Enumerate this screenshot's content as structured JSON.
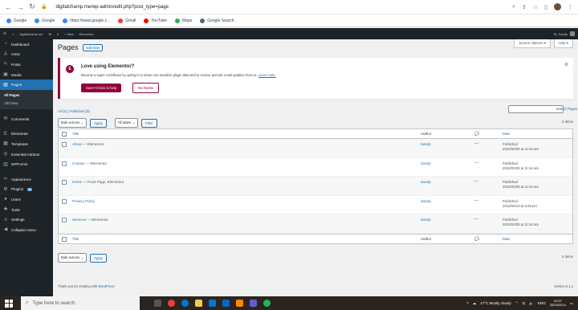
{
  "browser": {
    "url": "digitalchamp.me/wp-admin/edit.php?post_type=page",
    "lock": "🔒"
  },
  "bookmarks": [
    {
      "label": "Google",
      "color": "#4285f4"
    },
    {
      "label": "Google",
      "color": "#4285f4"
    },
    {
      "label": "https://www.google.c...",
      "color": "#4285f4"
    },
    {
      "label": "Gmail",
      "color": "#ea4335"
    },
    {
      "label": "YouTube",
      "color": "#ff0000"
    },
    {
      "label": "Maps",
      "color": "#34a853"
    },
    {
      "label": "Google Search",
      "color": "#5f6368"
    }
  ],
  "adminbar": {
    "site": "digitalchamp.me",
    "comments": "0",
    "new": "+ New",
    "elementor": "Elementor",
    "greeting": "Hi, Sandy"
  },
  "sidebar": {
    "items": [
      {
        "label": "Dashboard",
        "icon": "dashboard-icon"
      },
      {
        "label": "Astra",
        "icon": "astra-icon"
      },
      {
        "label": "Posts",
        "icon": "pin-icon"
      },
      {
        "label": "Media",
        "icon": "media-icon"
      },
      {
        "label": "Pages",
        "icon": "pages-icon"
      }
    ],
    "pages_sub": [
      "All Pages",
      "Add New"
    ],
    "items2": [
      {
        "label": "Comments",
        "icon": "comments-icon"
      }
    ],
    "items3": [
      {
        "label": "Elementor",
        "icon": "elementor-icon"
      },
      {
        "label": "Templates",
        "icon": "templates-icon"
      },
      {
        "label": "Essential Addons",
        "icon": "addons-icon"
      },
      {
        "label": "WPForms",
        "icon": "forms-icon"
      }
    ],
    "items4": [
      {
        "label": "Appearance",
        "icon": "brush-icon"
      },
      {
        "label": "Plugins",
        "icon": "plugin-icon",
        "badge": "1"
      },
      {
        "label": "Users",
        "icon": "users-icon"
      },
      {
        "label": "Tools",
        "icon": "tools-icon"
      },
      {
        "label": "Settings",
        "icon": "settings-icon"
      },
      {
        "label": "Collapse menu",
        "icon": "collapse-icon"
      }
    ]
  },
  "page": {
    "title": "Pages",
    "add_new": "Add New",
    "screen_options": "Screen Options ▾",
    "help": "Help ▾"
  },
  "notice": {
    "title": "Love using Elementor?",
    "text": "Become a super contributor by opting in to share non-sensitive plugin data and to receive periodic email updates from us.",
    "link": "Learn more.",
    "btn_help": "Sure! I'd love to help",
    "btn_no": "No thanks",
    "dismiss": "⊗"
  },
  "filters": {
    "all": "All (5)",
    "published": "Published (5)",
    "search_btn": "Search Pages",
    "bulk": "Bulk actions",
    "apply": "Apply",
    "dates": "All dates",
    "filter": "Filter",
    "items": "5 items"
  },
  "table": {
    "headers": {
      "title": "Title",
      "author": "Author",
      "comments": "💬",
      "date": "Date"
    },
    "rows": [
      {
        "title": "About",
        "state": " — Elementor",
        "author": "Sandy",
        "comments": "—",
        "status": "Published",
        "date": "2023/02/09 at 11:54 am"
      },
      {
        "title": "Contact",
        "state": " — Elementor",
        "author": "Sandy",
        "comments": "—",
        "status": "Published",
        "date": "2023/02/09 at 11:54 am"
      },
      {
        "title": "Home",
        "state": " — Front Page, Elementor",
        "author": "Sandy",
        "comments": "—",
        "status": "Published",
        "date": "2023/02/09 at 11:54 am"
      },
      {
        "title": "Privacy Policy",
        "state": "",
        "author": "Sandy",
        "comments": "—",
        "status": "Published",
        "date": "2023/02/10 at 6:05 pm"
      },
      {
        "title": "Services",
        "state": " — Elementor",
        "author": "Sandy",
        "comments": "—",
        "status": "Published",
        "date": "2023/02/09 at 11:54 am"
      }
    ]
  },
  "footer": {
    "text": "Thank you for creating with ",
    "link": "WordPress",
    "version": "Version 6.1.1"
  },
  "taskbar": {
    "search_placeholder": "Type here to search",
    "weather": "17°C  Mostly cloudy",
    "lang": "ENG",
    "time": "10:37",
    "date": "2023/02/14"
  }
}
